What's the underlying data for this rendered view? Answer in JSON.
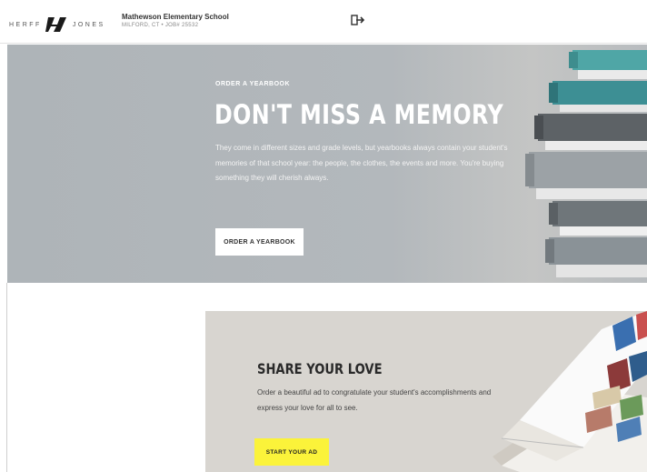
{
  "header": {
    "logo_left": "HERFF",
    "logo_right": "JONES",
    "school_name": "Mathewson Elementary School",
    "school_location": "MILFORD, CT • JOB# 25532",
    "signout_icon": "sign-out-icon"
  },
  "hero": {
    "eyebrow": "ORDER A YEARBOOK",
    "title": "DON'T MISS A MEMORY",
    "body": "They come in different sizes and grade levels, but yearbooks always contain your student's memories of that school year: the people, the clothes, the events and more. You're buying something they will cherish always.",
    "button_label": "ORDER A YEARBOOK",
    "image_icon": "book-stack-image"
  },
  "share": {
    "title": "SHARE YOUR LOVE",
    "body": "Order a beautiful ad to congratulate your student's accomplishments and express your love for all to see.",
    "button_label": "START YOUR AD",
    "image_icon": "open-yearbook-image"
  },
  "colors": {
    "hero_bg": "#aeb4b8",
    "share_bg": "#d8d5d0",
    "cta_yellow": "#fbf33a"
  }
}
